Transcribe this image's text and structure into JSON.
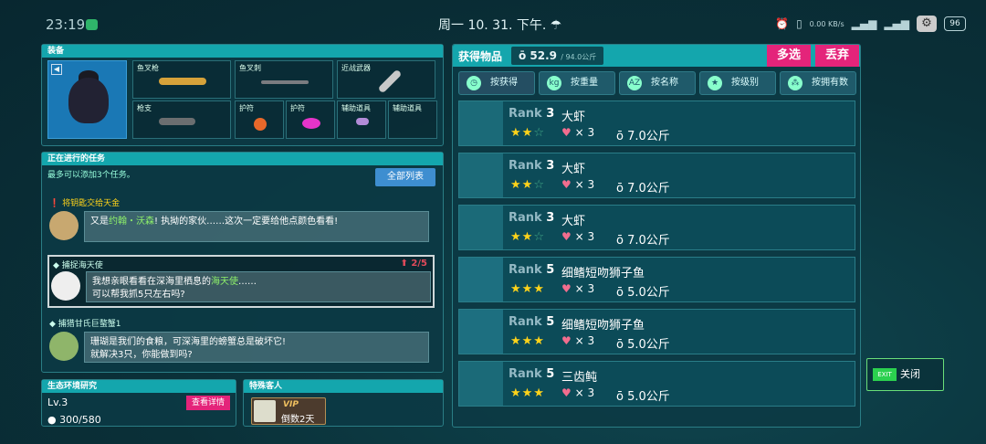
{
  "status": {
    "time": "23:19",
    "date": "周一 10. 31. 下午.",
    "network": "0.00 KB/s",
    "battery": "96"
  },
  "equip": {
    "title": "装备",
    "slots": [
      {
        "label": "鱼叉枪",
        "item": "harpoon-gun-icon"
      },
      {
        "label": "鱼叉刺",
        "item": "harpoon-tip-icon"
      },
      {
        "label": "近战武器",
        "item": "knife-icon"
      },
      {
        "label": "枪支",
        "item": "gun-icon"
      },
      {
        "label": "护符",
        "item": "charm-orange-icon"
      },
      {
        "label": "护符",
        "item": "charm-pink-icon"
      },
      {
        "label": "辅助道具",
        "item": "flashlight-icon"
      },
      {
        "label": "辅助道具",
        "item": "empty"
      }
    ]
  },
  "tasks": {
    "title": "正在进行的任务",
    "hint": "最多可以添加3个任务。",
    "all_btn": "全部列表",
    "items": [
      {
        "title": "将钥匙交给天金",
        "line1_a": "又是",
        "line1_name": "约翰・沃森",
        "line1_b": "! 执拗的家伙……这次一定要给他点颜色看看!",
        "line2": ""
      },
      {
        "title": "捕捉海天使",
        "progress": "2/5",
        "line1_a": "我想亲眼看看在深海里栖息的",
        "line1_name": "海天使",
        "line1_b": "……",
        "line2": "可以帮我抓5只左右吗?"
      },
      {
        "title": "捕猎甘氏巨螯蟹1",
        "line1_a": "珊瑚是我们的食粮，可深海里的螃蟹总是破坏它!",
        "line1_name": "",
        "line1_b": "",
        "line2": "就解决3只，你能做到吗?"
      }
    ]
  },
  "eco": {
    "title": "生态环境研究",
    "detail_btn": "查看详情",
    "level": "Lv.3",
    "xp": "300/580"
  },
  "guest": {
    "title": "特殊客人",
    "vip": "VIP",
    "countdown": "倒数2天"
  },
  "drops": {
    "title": "获得物品",
    "weight": "52.9",
    "weight_max": "/ 94.0公斤",
    "multi": "多选",
    "discard": "丢弃",
    "tabs": [
      "按获得",
      "按重量",
      "按名称",
      "按级别",
      "按拥有数"
    ],
    "rows": [
      {
        "rank_label": "Rank",
        "rank": "3",
        "name": "大虾",
        "stars": 2,
        "count": "× 3",
        "weight": "7.0",
        "unit": "公斤"
      },
      {
        "rank_label": "Rank",
        "rank": "3",
        "name": "大虾",
        "stars": 2,
        "count": "× 3",
        "weight": "7.0",
        "unit": "公斤"
      },
      {
        "rank_label": "Rank",
        "rank": "3",
        "name": "大虾",
        "stars": 2,
        "count": "× 3",
        "weight": "7.0",
        "unit": "公斤"
      },
      {
        "rank_label": "Rank",
        "rank": "5",
        "name": "细鳍短吻狮子鱼",
        "stars": 3,
        "count": "× 3",
        "weight": "5.0",
        "unit": "公斤"
      },
      {
        "rank_label": "Rank",
        "rank": "5",
        "name": "细鳍短吻狮子鱼",
        "stars": 3,
        "count": "× 3",
        "weight": "5.0",
        "unit": "公斤"
      },
      {
        "rank_label": "Rank",
        "rank": "5",
        "name": "三齿鲀",
        "stars": 3,
        "count": "× 3",
        "weight": "5.0",
        "unit": "公斤"
      }
    ]
  },
  "exit": {
    "badge": "EXIT",
    "label": "关闭"
  }
}
